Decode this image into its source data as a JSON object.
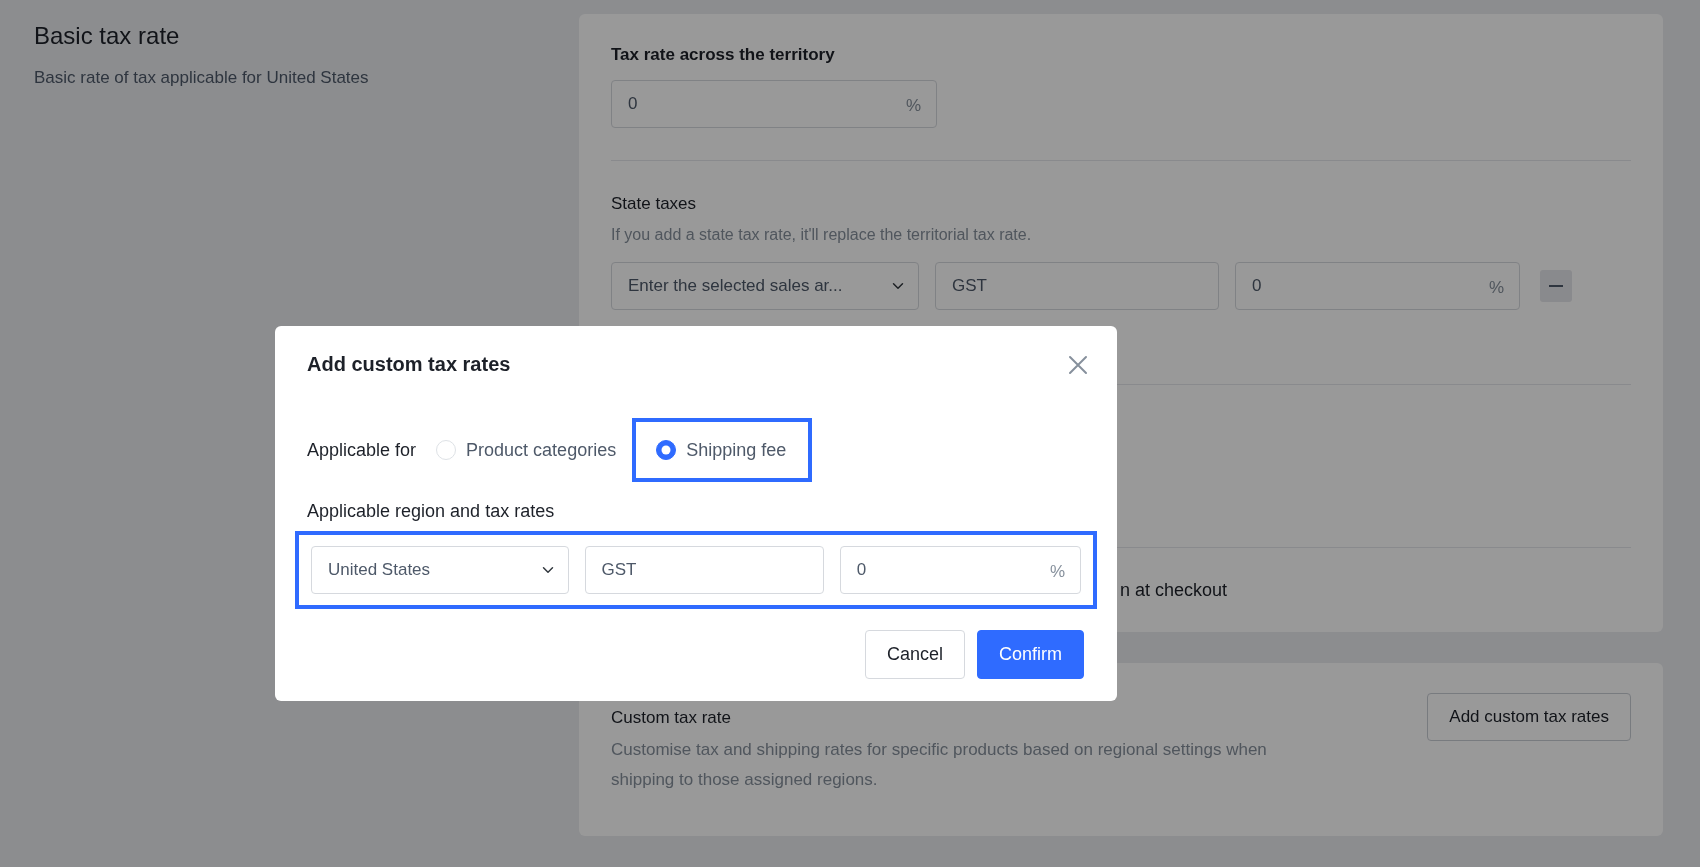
{
  "page": {
    "title": "Basic tax rate",
    "description": "Basic rate of tax applicable for United States"
  },
  "territory": {
    "label": "Tax rate across the territory",
    "value": "0",
    "unit": "%"
  },
  "state_taxes": {
    "title": "State taxes",
    "description": "If you add a state tax rate, it'll replace the territorial tax rate.",
    "row": {
      "region": "Enter the selected sales ar...",
      "name": "GST",
      "rate": "0",
      "unit": "%"
    }
  },
  "checkout_fragment": "n at checkout",
  "custom_tax": {
    "title": "Custom tax rate",
    "description": "Customise tax and shipping rates for specific products based on regional settings when shipping to those assigned regions.",
    "button": "Add custom tax rates"
  },
  "modal": {
    "title": "Add custom tax rates",
    "applicable_label": "Applicable for",
    "options": [
      {
        "label": "Product categories",
        "selected": false,
        "highlighted": false
      },
      {
        "label": "Shipping fee",
        "selected": true,
        "highlighted": true
      }
    ],
    "region_label": "Applicable region and tax rates",
    "row": {
      "region": "United States",
      "name": "GST",
      "rate": "0",
      "unit": "%",
      "highlighted": true
    },
    "buttons": [
      {
        "label": "Cancel",
        "kind": "secondary"
      },
      {
        "label": "Confirm",
        "kind": "primary"
      }
    ]
  }
}
